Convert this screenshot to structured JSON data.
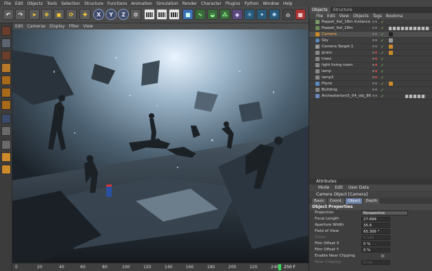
{
  "menubar": [
    "File",
    "Edit",
    "Objects",
    "Tools",
    "Selection",
    "Structure",
    "Functions",
    "Animation",
    "Simulation",
    "Render",
    "Character",
    "Plugins",
    "Python",
    "Window",
    "Help"
  ],
  "toolbar": {
    "axis_x": "X",
    "axis_y": "Y",
    "axis_z": "Z"
  },
  "viewport": {
    "menu": [
      "Edit",
      "Cameras",
      "Display",
      "Filter",
      "View"
    ]
  },
  "timeline": {
    "ticks": [
      "0",
      "20",
      "40",
      "60",
      "80",
      "100",
      "120",
      "140",
      "160",
      "180",
      "200",
      "220",
      "240"
    ],
    "current_frame": "250 F"
  },
  "panel": {
    "tabs": [
      "Objects",
      "Structure"
    ],
    "menu": [
      "File",
      "Edit",
      "View",
      "Objects",
      "Tags",
      "Bookma"
    ],
    "objects": [
      {
        "name": "Pappel_Ital_18m Instance"
      },
      {
        "name": "Pappel_Ital_18m"
      },
      {
        "name": "Camera"
      },
      {
        "name": "Sky"
      },
      {
        "name": "Camera.Target.1"
      },
      {
        "name": "grass"
      },
      {
        "name": "trees"
      },
      {
        "name": "light living room"
      },
      {
        "name": "lamp"
      },
      {
        "name": "lamp2"
      },
      {
        "name": "Plane"
      },
      {
        "name": "Building"
      },
      {
        "name": "Archexteriors5_04_obj_86"
      }
    ]
  },
  "attributes": {
    "header": "Attributes",
    "menu": [
      "Mode",
      "Edit",
      "User Data"
    ],
    "title": "Camera Object [Camera]",
    "tabs": [
      "Basic",
      "Coord.",
      "Object",
      "Depth"
    ],
    "section": "Object Properties",
    "rows": [
      {
        "label": "Projection",
        "value": "Perspective"
      },
      {
        "label": "Focal Length",
        "value": "27.699"
      },
      {
        "label": "Aperture Width",
        "value": "35.6"
      },
      {
        "label": "Field of View",
        "value": "65.306 °"
      },
      {
        "label": "Zoom",
        "value": "0.145"
      },
      {
        "label": "Film Offset X",
        "value": "0 %"
      },
      {
        "label": "Film Offset Y",
        "value": "0 %"
      },
      {
        "label": "Enable Near Clipping",
        "value": ""
      },
      {
        "label": "Near Clipping",
        "value": "0 cm"
      }
    ]
  }
}
